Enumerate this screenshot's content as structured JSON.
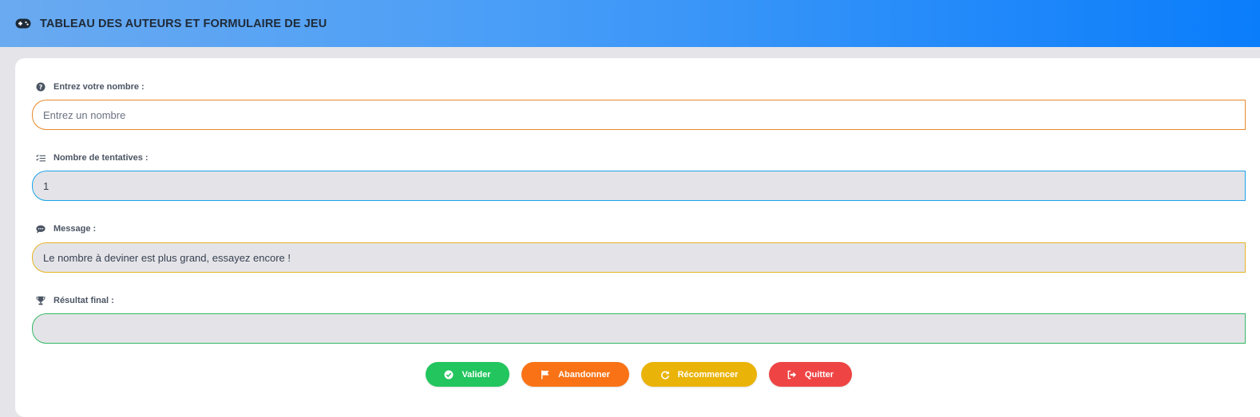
{
  "header": {
    "title": "TABLEAU DES AUTEURS ET FORMULAIRE DE JEU",
    "icon": "gamepad-icon"
  },
  "form": {
    "number": {
      "label": "Entrez votre nombre :",
      "placeholder": "Entrez un nombre",
      "value": "",
      "icon": "question-circle-icon",
      "border_color": "#f28c28"
    },
    "attempts": {
      "label": "Nombre de tentatives :",
      "value": "1",
      "icon": "list-check-icon",
      "border_color": "#1aa3e8"
    },
    "message": {
      "label": "Message :",
      "value": "Le nombre à deviner est plus grand, essayez encore !",
      "icon": "comment-icon",
      "border_color": "#e6b422"
    },
    "result": {
      "label": "Résultat final :",
      "value": "",
      "icon": "trophy-icon",
      "border_color": "#33b864"
    }
  },
  "buttons": {
    "validate": {
      "label": "Valider",
      "icon": "check-circle-icon",
      "color": "#22c55e"
    },
    "abandon": {
      "label": "Abandonner",
      "icon": "flag-icon",
      "color": "#f97316"
    },
    "restart": {
      "label": "Récommencer",
      "icon": "redo-icon",
      "color": "#eab308"
    },
    "quit": {
      "label": "Quitter",
      "icon": "sign-out-icon",
      "color": "#ef4444"
    }
  }
}
